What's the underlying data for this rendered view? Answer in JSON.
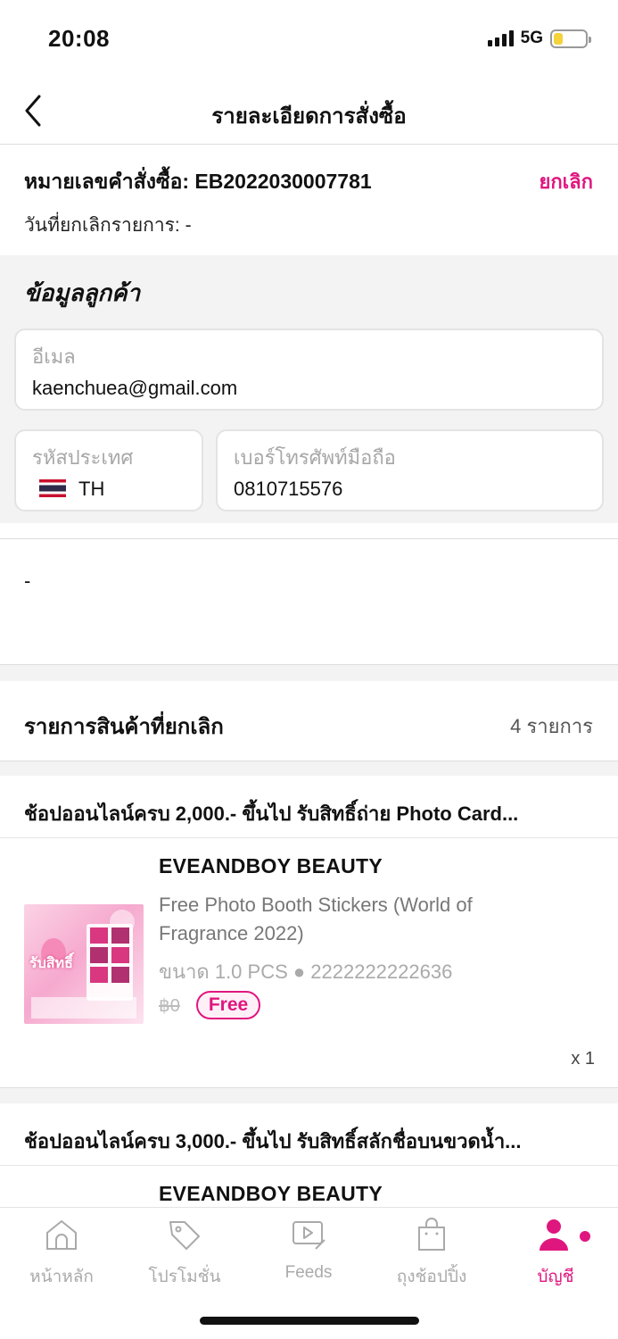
{
  "status": {
    "time": "20:08",
    "network": "5G",
    "battery_level": 0.3
  },
  "nav": {
    "title": "รายละเอียดการสั่งซื้อ",
    "back_icon": "chevron-left-icon"
  },
  "order": {
    "number_label": "หมายเลขคำสั่งซื้อ: EB202203000​7781",
    "cancel_label": "ยกเลิก",
    "cancel_date_label": "วันที่ยกเลิกรายการ:  -"
  },
  "customer": {
    "title": "ข้อมูลลูกค้า",
    "email_label": "อีเมล",
    "email_value": "kaenchuea@gmail.com",
    "country_label": "รหัสประเทศ",
    "country_value": "TH",
    "phone_label": "เบอร์โทรศัพท์มือถือ",
    "phone_value": "0810715576"
  },
  "note": {
    "text": "-"
  },
  "items": {
    "title": "รายการสินค้าที่ยกเลิก",
    "count_label": "4 รายการ",
    "list": [
      {
        "promo": "ช้อปออนไลน์ครบ 2,000.- ขึ้นไป รับสิทธิ์ถ่าย Photo Card...",
        "brand": "EVEANDBOY BEAUTY",
        "name": "Free Photo Booth Stickers  (World of Fragrance 2022)",
        "variant": "ขนาด 1.0 PCS ● 2222222222636",
        "old_price": "฿0",
        "badge": "Free",
        "qty": "x 1",
        "thumb_text": "รับสิทธิ์"
      },
      {
        "promo": "ช้อปออนไลน์ครบ 3,000.- ขึ้นไป รับสิทธิ์สลักชื่อบนขวดน้ำ...",
        "brand": "EVEANDBOY BEAUTY"
      }
    ]
  },
  "tabs": [
    {
      "label": "หน้าหลัก",
      "icon": "home-icon"
    },
    {
      "label": "โปรโมชั่น",
      "icon": "tag-icon"
    },
    {
      "label": "Feeds",
      "icon": "video-icon"
    },
    {
      "label": "ถุงช้อปปิ้ง",
      "icon": "shopping-bag-icon"
    },
    {
      "label": "บัญชี",
      "icon": "account-icon",
      "active": true
    }
  ],
  "colors": {
    "accent": "#e0167f",
    "section_bg": "#f3f3f3"
  }
}
